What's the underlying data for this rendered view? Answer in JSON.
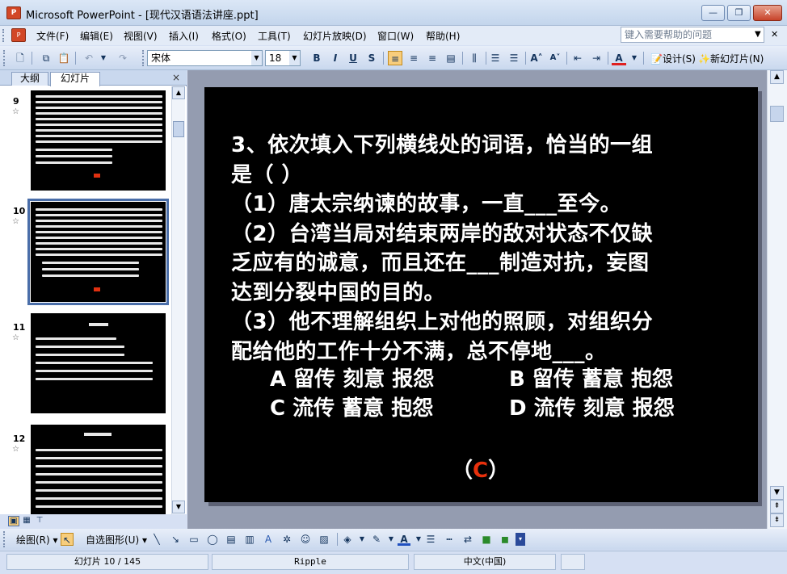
{
  "window": {
    "title": "Microsoft PowerPoint - [现代汉语语法讲座.ppt]",
    "app_icon_label": "P",
    "minimize": "0",
    "restore": "1",
    "close": "r"
  },
  "menubar": {
    "items": [
      "文件(F)",
      "编辑(E)",
      "视图(V)",
      "插入(I)",
      "格式(O)",
      "工具(T)",
      "幻灯片放映(D)",
      "窗口(W)",
      "帮助(H)"
    ],
    "help_placeholder": "键入需要帮助的问题"
  },
  "toolbar": {
    "font_name": "宋体",
    "font_size": "18",
    "bold": "B",
    "italic": "I",
    "underline": "U",
    "shadow": "S",
    "design_label": "设计(S)",
    "new_slide_label": "新幻灯片(N)",
    "font_color_letter": "A"
  },
  "pane": {
    "tab_outline": "大纲",
    "tab_slides": "幻灯片",
    "tab_close": "×",
    "slides": [
      {
        "number": "9",
        "star": "☆"
      },
      {
        "number": "10",
        "star": "☆"
      },
      {
        "number": "11",
        "star": "☆"
      },
      {
        "number": "12",
        "star": "☆"
      }
    ]
  },
  "slide": {
    "question_lines": [
      "3、依次填入下列横线处的词语，恰当的一组",
      "是（  ）",
      "（1）唐太宗纳谏的故事，一直___至今。",
      "（2）台湾当局对结束两岸的敌对状态不仅缺",
      "乏应有的诚意，而且还在___制造对抗，妄图",
      "达到分裂中国的目的。",
      "（3）他不理解组织上对他的照顾，对组织分",
      "配给他的工作十分不满，总不停地___。"
    ],
    "options": {
      "a": "A 留传  刻意 报怨",
      "b": "B 留传  蓄意  抱怨",
      "c": "C 流传  蓄意  抱怨",
      "d": "D 流传  刻意  报怨"
    },
    "answer_open": "（",
    "answer_letter": "C",
    "answer_close": "）"
  },
  "drawbar": {
    "draw_label": "绘图(R)",
    "autoshapes_label": "自选图形(U)"
  },
  "status": {
    "slide_position": "幻灯片 10 / 145",
    "design_template": "Ripple",
    "language": "中文(中国)"
  },
  "colors": {
    "slide_bg": "#000000",
    "slide_text": "#ffffff",
    "answer_color": "#e8300c",
    "chrome": "#d6e0f3"
  }
}
